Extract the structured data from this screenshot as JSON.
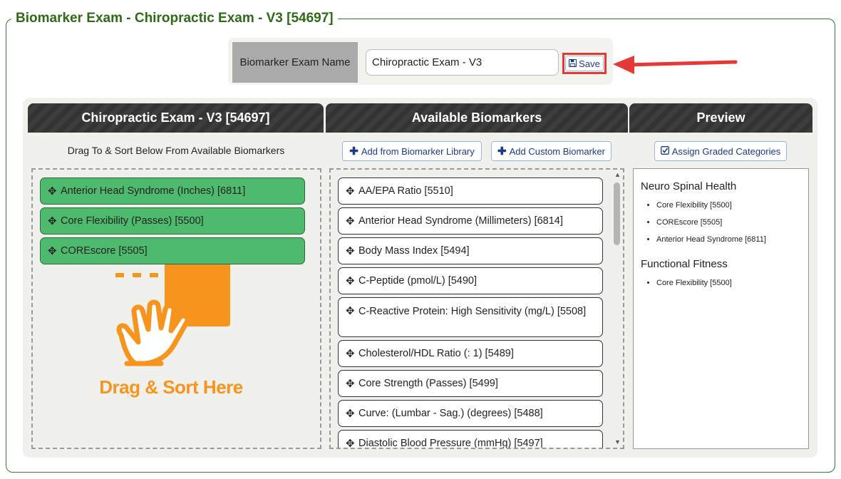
{
  "title": "Biomarker Exam - Chiropractic Exam - V3 [54697]",
  "name_row": {
    "label": "Biomarker Exam Name",
    "value": "Chiropractic Exam - V3",
    "save_label": "Save"
  },
  "columns": {
    "selected_header": "Chiropractic Exam - V3 [54697]",
    "available_header": "Available Biomarkers",
    "preview_header": "Preview"
  },
  "instructions": "Drag To & Sort Below From Available Biomarkers",
  "buttons": {
    "add_library": "Add from Biomarker Library",
    "add_custom": "Add Custom Biomarker",
    "assign_categories": "Assign Graded Categories"
  },
  "drop_placeholder": "Drag & Sort Here",
  "selected_items": [
    "Anterior Head Syndrome (Inches) [6811]",
    "Core Flexibility (Passes) [5500]",
    "COREscore [5505]"
  ],
  "available_items": [
    "AA/EPA Ratio [5510]",
    "Anterior Head Syndrome (Millimeters) [6814]",
    "Body Mass Index [5494]",
    "C-Peptide (pmol/L) [5490]",
    "C-Reactive Protein: High Sensitivity (mg/L) [5508]",
    "Cholesterol/HDL Ratio (: 1) [5489]",
    "Core Strength (Passes) [5499]",
    "Curve: (Lumbar - Sag.) (degrees) [5488]",
    "Diastolic Blood Pressure (mmHg) [5497]"
  ],
  "preview": {
    "groups": [
      {
        "name": "Neuro Spinal Health",
        "items": [
          "Core Flexibility [5500]",
          "COREscore [5505]",
          "Anterior Head Syndrome [6811]"
        ]
      },
      {
        "name": "Functional Fitness",
        "items": [
          "Core Flexibility [5500]"
        ]
      }
    ]
  },
  "colors": {
    "title_green": "#2e6b17",
    "selected_green": "#4dba6e",
    "accent_orange": "#f7941d",
    "highlight_red": "#e53935",
    "header_dark": "#333333"
  }
}
